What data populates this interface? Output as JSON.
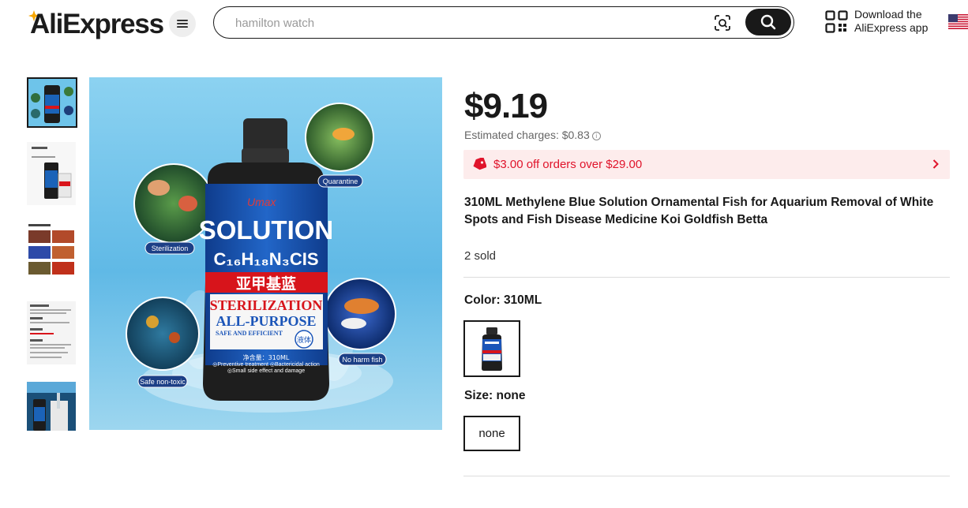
{
  "header": {
    "logo_text": "AliExpress",
    "search": {
      "placeholder": "hamilton watch"
    },
    "app_download": {
      "line1": "Download the",
      "line2": "AliExpress app"
    }
  },
  "product": {
    "price": "$9.19",
    "estimated_charges": "Estimated charges: $0.83",
    "promo": "$3.00 off orders over $29.00",
    "title": "310ML Methylene Blue Solution Ornamental Fish for Aquarium Removal of White Spots and Fish Disease Medicine Koi Goldfish Betta",
    "sold": "2 sold",
    "color": {
      "label": "Color: ",
      "value": "310ML"
    },
    "size": {
      "label": "Size: ",
      "value": "none",
      "options": [
        "none"
      ]
    }
  },
  "main_image": {
    "brand": "Umax",
    "solution": "SOLUTION",
    "cn_label": "亚甲基蓝",
    "sterilization": "STERILIZATION",
    "all_purpose": "ALL-PURPOSE",
    "safe": "SAFE AND EFFICIENT",
    "liquid": "液体",
    "volume": "净含量：310ML",
    "line1": "◎Preventive treatment  ◎Bactericidal action",
    "line2": "◎Small side effect and damage",
    "bubbles": [
      "Quarantine",
      "Sterilization",
      "No harm fish",
      "Safe non-toxic"
    ]
  },
  "thumbnails": [
    {
      "name": "Bottle front"
    },
    {
      "name": "Bottle with box"
    },
    {
      "name": "Fish comparison"
    },
    {
      "name": "Usage text"
    },
    {
      "name": "Dosing photo"
    }
  ],
  "colors": {
    "accent": "#e0142b",
    "promo_bg": "#fdecec",
    "text": "#191919"
  }
}
